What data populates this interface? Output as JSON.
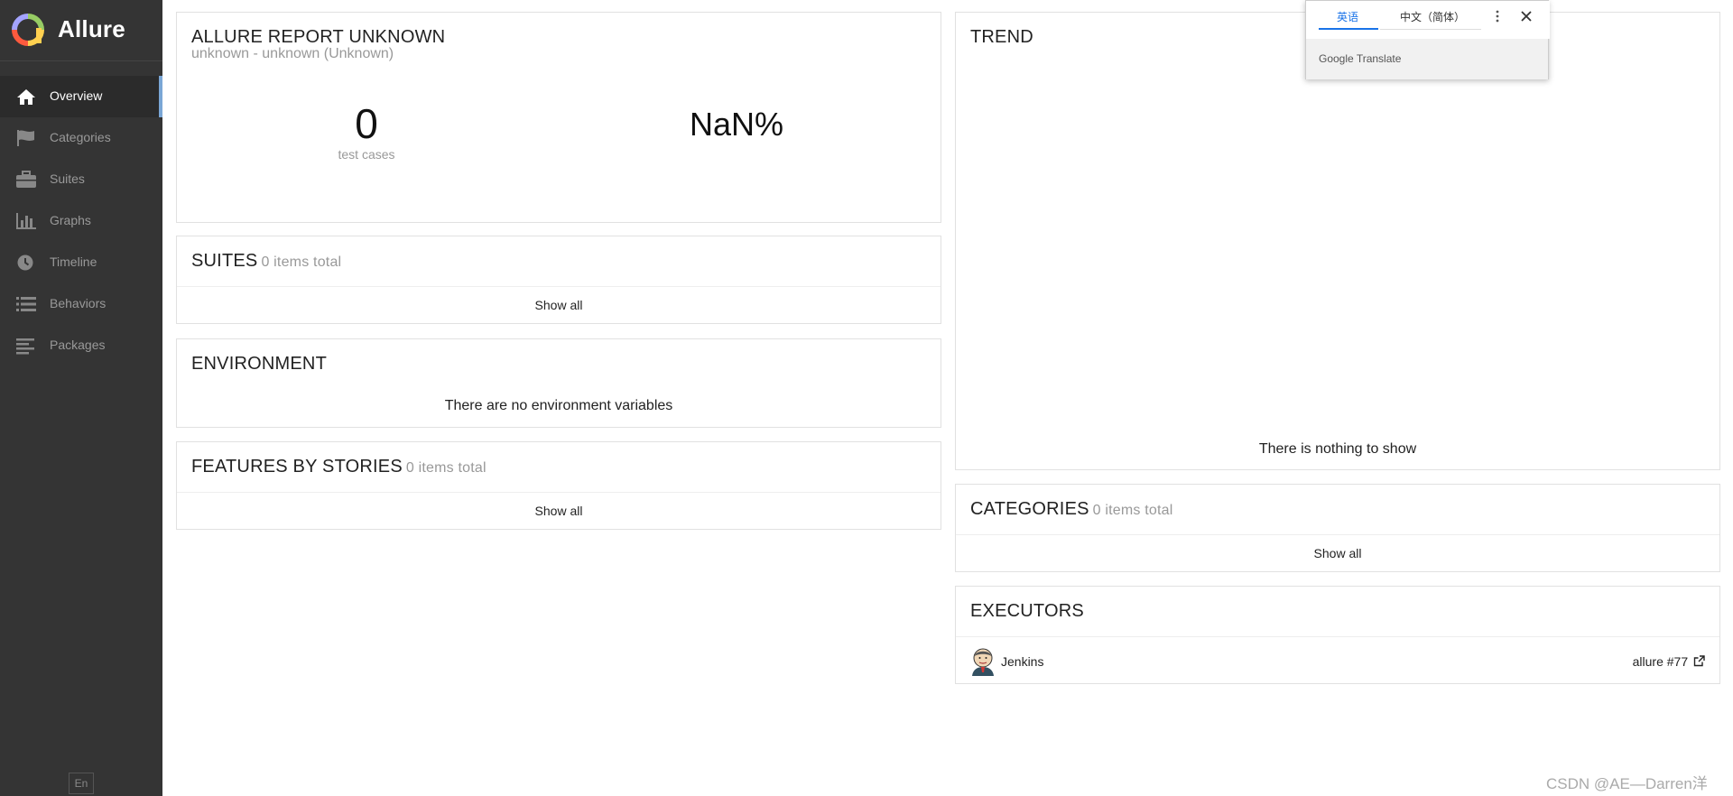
{
  "app": {
    "name": "Allure",
    "lang_button": "En"
  },
  "sidebar": {
    "items": [
      {
        "label": "Overview",
        "icon": "home-icon",
        "active": true
      },
      {
        "label": "Categories",
        "icon": "flag-icon",
        "active": false
      },
      {
        "label": "Suites",
        "icon": "briefcase-icon",
        "active": false
      },
      {
        "label": "Graphs",
        "icon": "bar-chart-icon",
        "active": false
      },
      {
        "label": "Timeline",
        "icon": "clock-icon",
        "active": false
      },
      {
        "label": "Behaviors",
        "icon": "list-icon",
        "active": false
      },
      {
        "label": "Packages",
        "icon": "align-left-icon",
        "active": false
      }
    ]
  },
  "summary": {
    "title": "ALLURE REPORT UNKNOWN",
    "subtitle": "unknown - unknown (Unknown)",
    "test_cases_count": "0",
    "test_cases_label": "test cases",
    "success_rate": "NaN%"
  },
  "suites": {
    "title": "SUITES",
    "count": "0 items total",
    "show_all": "Show all"
  },
  "environment": {
    "title": "ENVIRONMENT",
    "empty": "There are no environment variables"
  },
  "features": {
    "title": "FEATURES BY STORIES",
    "count": "0 items total",
    "show_all": "Show all"
  },
  "trend": {
    "title": "TREND",
    "empty": "There is nothing to show"
  },
  "categories": {
    "title": "CATEGORIES",
    "count": "0 items total",
    "show_all": "Show all"
  },
  "executors": {
    "title": "EXECUTORS",
    "name": "Jenkins",
    "build": "allure #77"
  },
  "translate": {
    "source_lang": "英语",
    "target_lang": "中文（简体）",
    "brand": "Google Translate"
  },
  "watermark": "CSDN @AE—Darren洋",
  "colors": {
    "sidebar_bg": "#343434",
    "active_accent": "#7aa7d6",
    "translate_accent": "#1a73e8"
  }
}
